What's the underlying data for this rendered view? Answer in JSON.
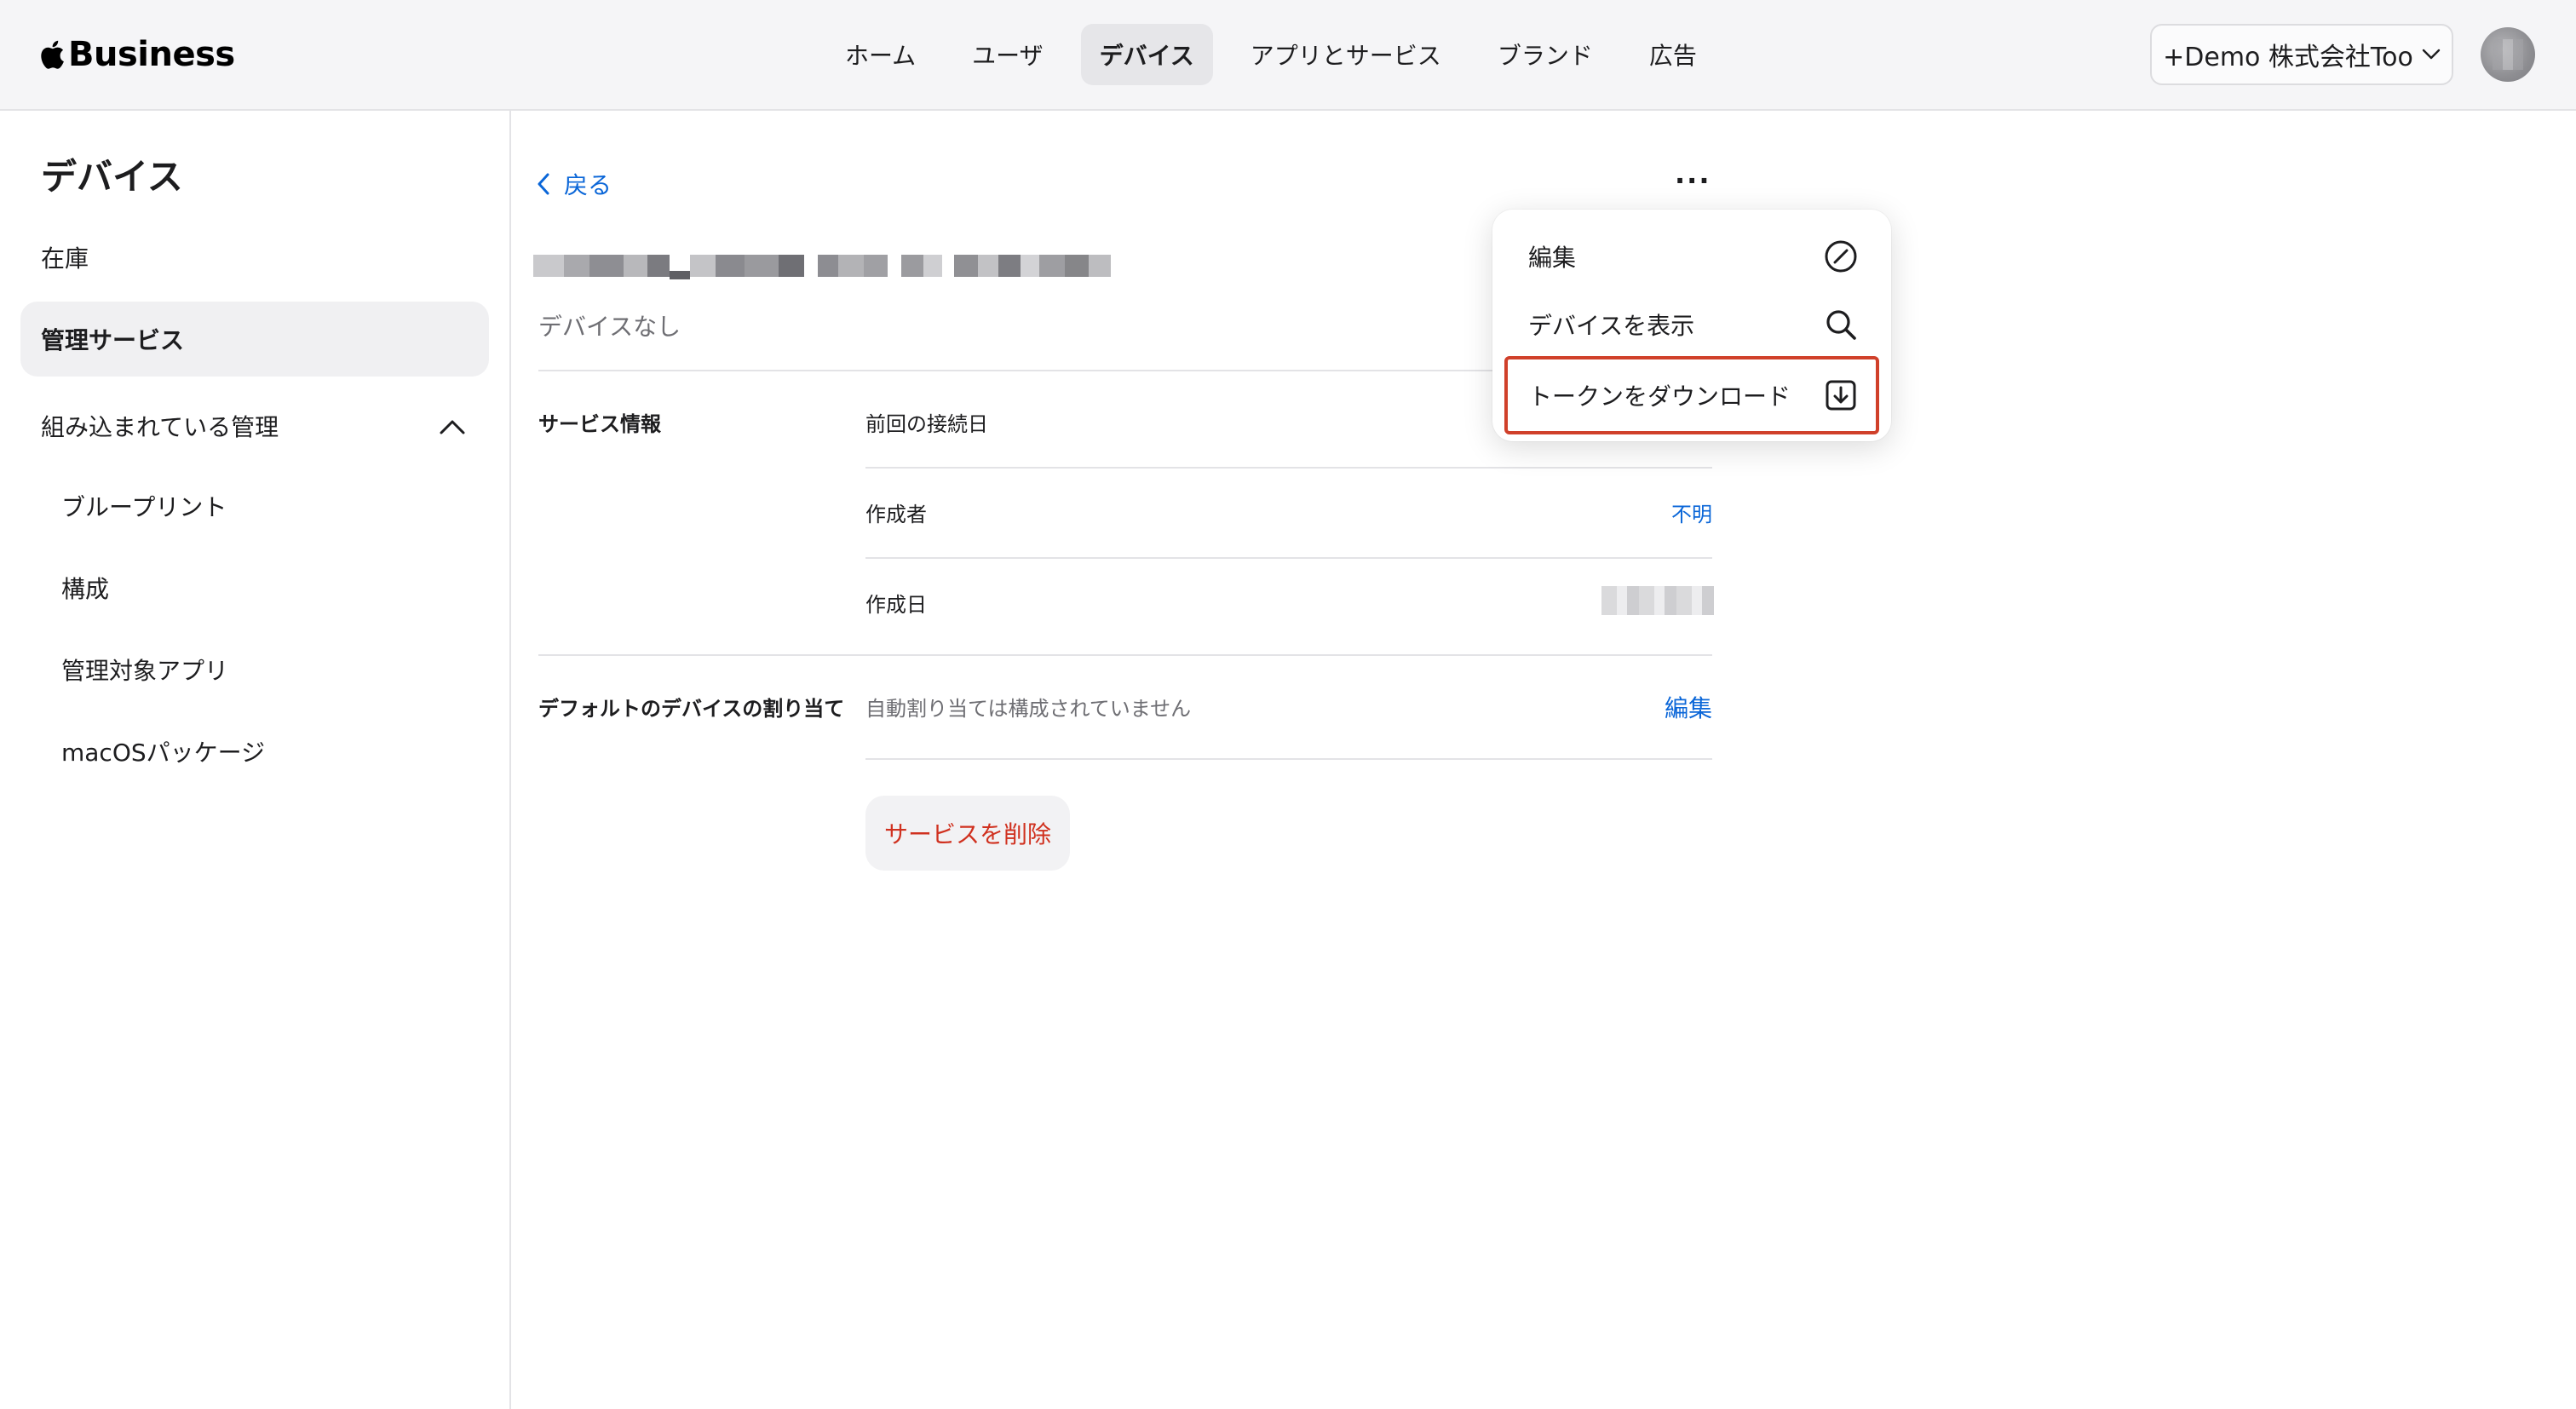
{
  "header": {
    "brand": "Business",
    "nav": [
      "ホーム",
      "ユーザ",
      "デバイス",
      "アプリとサービス",
      "ブランド",
      "広告"
    ],
    "active_nav": "デバイス",
    "account": "+Demo 株式会社Too"
  },
  "sidebar": {
    "title": "デバイス",
    "items": {
      "inventory": "在庫",
      "management_services": "管理サービス",
      "built_in_management": "組み込まれている管理",
      "blueprints": "ブループリント",
      "configurations": "構成",
      "managed_apps": "管理対象アプリ",
      "macos_packages": "macOSパッケージ"
    }
  },
  "main": {
    "back_label": "戻る",
    "more_label": "···",
    "subtitle": "デバイスなし",
    "service_info_label": "サービス情報",
    "fields": {
      "last_connected_label": "前回の接続日",
      "creator_label": "作成者",
      "creator_value": "不明",
      "created_date_label": "作成日"
    },
    "default_assignment_label": "デフォルトのデバイスの割り当て",
    "default_assignment_value": "自動割り当ては構成されていません",
    "edit_link": "編集",
    "delete_button": "サービスを削除"
  },
  "menu": {
    "items": [
      {
        "label": "編集",
        "icon": "edit-slash-circle-icon"
      },
      {
        "label": "デバイスを表示",
        "icon": "search-icon"
      },
      {
        "label": "トークンをダウンロード",
        "icon": "download-icon"
      }
    ],
    "highlighted": "トークンをダウンロード"
  },
  "colors": {
    "link": "#0a66d8",
    "destructive": "#d0311f",
    "highlight_border": "#d0402a"
  }
}
